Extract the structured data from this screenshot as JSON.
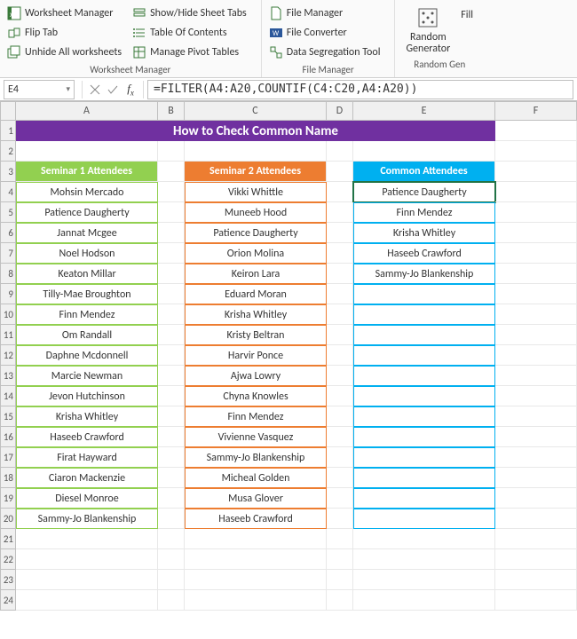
{
  "ribbon": {
    "worksheet_manager": {
      "label": "Worksheet Manager",
      "btns": {
        "wm": "Worksheet Manager",
        "flip": "Flip Tab",
        "unhide": "Unhide All worksheets",
        "showhide": "Show/Hide Sheet Tabs",
        "toc": "Table Of Contents",
        "pivot": "Manage Pivot Tables"
      }
    },
    "file_manager": {
      "label": "File Manager",
      "btns": {
        "fm": "File Manager",
        "conv": "File Converter",
        "seg": "Data Segregation Tool"
      }
    },
    "random_gen": {
      "label": "Random Gen",
      "btns": {
        "rand": "Random\nGenerator",
        "fill": "Fill"
      }
    }
  },
  "namebox": "E4",
  "formula": "=FILTER(A4:A20,COUNTIF(C4:C20,A4:A20))",
  "col_letters": [
    "A",
    "B",
    "C",
    "D",
    "E",
    "F"
  ],
  "title": "How to Check Common Name",
  "headers": {
    "a": "Seminar 1 Attendees",
    "c": "Seminar 2 Attendees",
    "e": "Common Attendees"
  },
  "listA": [
    "Mohsin Mercado",
    "Patience Daugherty",
    "Jannat Mcgee",
    "Noel Hodson",
    "Keaton Millar",
    "Tilly-Mae Broughton",
    "Finn Mendez",
    "Om Randall",
    "Daphne Mcdonnell",
    "Marcie Newman",
    "Jevon Hutchinson",
    "Krisha Whitley",
    "Haseeb Crawford",
    "Firat Hayward",
    "Ciaron Mackenzie",
    "Diesel Monroe",
    "Sammy-Jo Blankenship"
  ],
  "listC": [
    "Vikki Whittle",
    "Muneeb Hood",
    "Patience Daugherty",
    "Orion Molina",
    "Keiron Lara",
    "Eduard Moran",
    "Krisha Whitley",
    "Kristy Beltran",
    "Harvir Ponce",
    "Ajwa Lowry",
    "Chyna Knowles",
    "Finn Mendez",
    "Vivienne Vasquez",
    "Sammy-Jo Blankenship",
    "Micheal Golden",
    "Musa Glover",
    "Haseeb Crawford"
  ],
  "listE": [
    "Patience Daugherty",
    "Finn Mendez",
    "Krisha Whitley",
    "Haseeb Crawford",
    "Sammy-Jo Blankenship"
  ],
  "chart_data": {
    "type": "table",
    "title": "How to Check Common Name",
    "columns": [
      "Seminar 1 Attendees",
      "Seminar 2 Attendees",
      "Common Attendees"
    ],
    "data": {
      "Seminar 1 Attendees": [
        "Mohsin Mercado",
        "Patience Daugherty",
        "Jannat Mcgee",
        "Noel Hodson",
        "Keaton Millar",
        "Tilly-Mae Broughton",
        "Finn Mendez",
        "Om Randall",
        "Daphne Mcdonnell",
        "Marcie Newman",
        "Jevon Hutchinson",
        "Krisha Whitley",
        "Haseeb Crawford",
        "Firat Hayward",
        "Ciaron Mackenzie",
        "Diesel Monroe",
        "Sammy-Jo Blankenship"
      ],
      "Seminar 2 Attendees": [
        "Vikki Whittle",
        "Muneeb Hood",
        "Patience Daugherty",
        "Orion Molina",
        "Keiron Lara",
        "Eduard Moran",
        "Krisha Whitley",
        "Kristy Beltran",
        "Harvir Ponce",
        "Ajwa Lowry",
        "Chyna Knowles",
        "Finn Mendez",
        "Vivienne Vasquez",
        "Sammy-Jo Blankenship",
        "Micheal Golden",
        "Musa Glover",
        "Haseeb Crawford"
      ],
      "Common Attendees": [
        "Patience Daugherty",
        "Finn Mendez",
        "Krisha Whitley",
        "Haseeb Crawford",
        "Sammy-Jo Blankenship"
      ]
    }
  }
}
